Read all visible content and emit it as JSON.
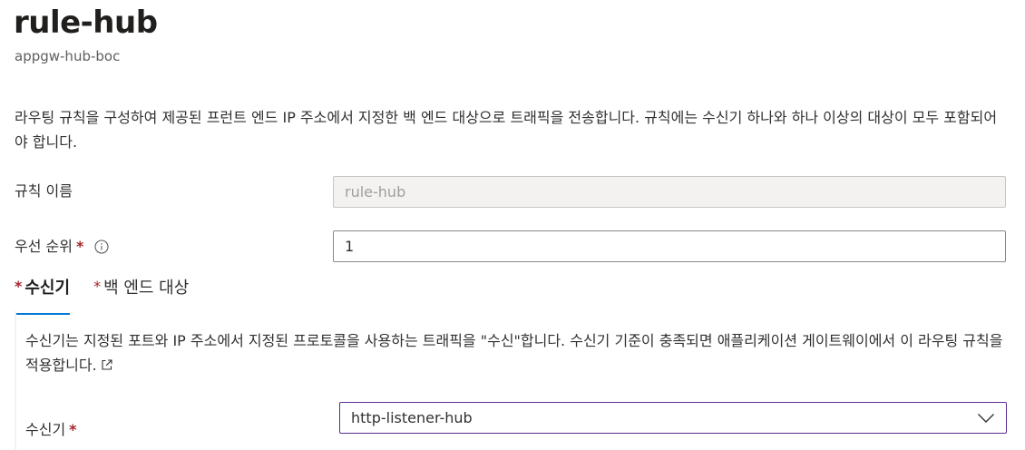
{
  "header": {
    "title": "rule-hub",
    "subtitle": "appgw-hub-boc"
  },
  "description": "라우팅 규칙을 구성하여 제공된 프런트 엔드 IP 주소에서 지정한 백 엔드 대상으로 트래픽을 전송합니다. 규칙에는 수신기 하나와 하나 이상의 대상이 모두 포함되어야 합니다.",
  "form": {
    "rule_name": {
      "label": "규칙 이름",
      "value": "rule-hub"
    },
    "priority": {
      "label": "우선 순위",
      "required_mark": "*",
      "value": "1"
    }
  },
  "tabs": [
    {
      "star": "*",
      "label": "수신기",
      "active": true
    },
    {
      "star": "*",
      "label": "백 엔드 대상",
      "active": false
    }
  ],
  "listener_panel": {
    "description": "수신기는 지정된 포트와 IP 주소에서 지정된 프로토콜을 사용하는 트래픽을 \"수신\"합니다. 수신기 기준이 충족되면 애플리케이션 게이트웨이에서 이 라우팅 규칙을 적용합니다.",
    "listener_label": "수신기",
    "required_mark": "*",
    "listener_value": "http-listener-hub"
  },
  "colors": {
    "accent": "#0078d4",
    "required": "#a4262c",
    "select_border": "#5c2e91"
  },
  "icons": {
    "info": "info-icon",
    "external_link": "external-link-icon",
    "dropdown": "chevron-down-icon"
  }
}
